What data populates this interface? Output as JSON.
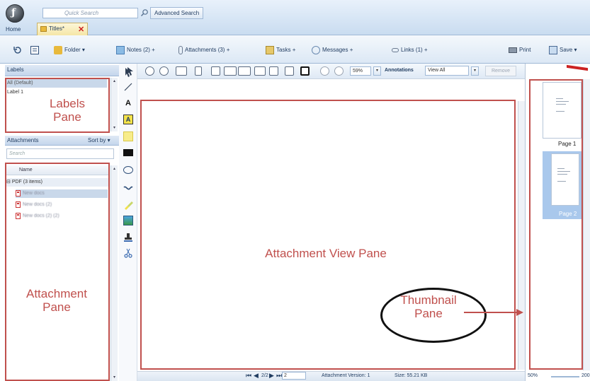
{
  "header": {
    "quick_search_placeholder": "Quick Search",
    "advanced_search_label": "Advanced Search",
    "home_tab_label": "Home",
    "doc_tab_label": "Titles*"
  },
  "toolbar": {
    "folder_label": "Folder",
    "notes_label": "Notes (2)",
    "attachments_label": "Attachments (3)",
    "tasks_label": "Tasks",
    "messages_label": "Messages",
    "links_label": "Links (1)",
    "print_label": "Print",
    "save_label": "Save",
    "plus": "+",
    "caret": "▾"
  },
  "labels_panel": {
    "header": "Labels",
    "items": [
      "All (Default)",
      "Label 1"
    ]
  },
  "attachments_panel": {
    "header": "Attachments",
    "sort_label": "Sort by",
    "search_placeholder": "Search",
    "column_name": "Name",
    "group_label": "PDF (3 items)",
    "files": [
      "New docs",
      "New docs (2)",
      "New docs (2) (2)"
    ]
  },
  "viewer": {
    "zoom_value": "59%",
    "annotations_label": "Annotations",
    "annotations_value": "View All",
    "remove_label": "Remove",
    "page_indicator": "2/2",
    "page_input": "2",
    "version_label": "Attachment Version: 1",
    "size_label": "Size: 55.21 KB"
  },
  "thumbnails": {
    "pages": [
      "Page 1",
      "Page 2"
    ],
    "zoom_min": "50%",
    "zoom_max": "200"
  },
  "annotations": {
    "labels_pane": "Labels\nPane",
    "attachment_pane": "Attachment\nPane",
    "attachment_view_pane": "Attachment View Pane",
    "thumbnail_pane": "Thumbnail\nPane"
  },
  "colors": {
    "annotation_red": "#c0504d",
    "chrome_blue": "#c9dcf0",
    "thumb_selected": "#a9c8ec"
  }
}
